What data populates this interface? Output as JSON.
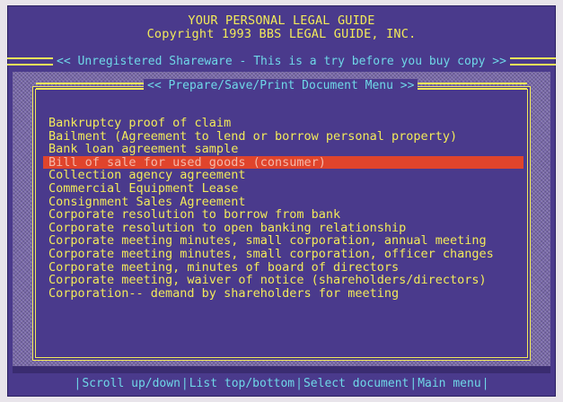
{
  "header": {
    "line1": "YOUR PERSONAL LEGAL GUIDE",
    "line2": "Copyright 1993 BBS LEGAL GUIDE, INC.",
    "banner": "<< Unregistered Shareware - This is a try before you buy copy >>"
  },
  "panel": {
    "title": "<< Prepare/Save/Print Document Menu >>"
  },
  "menu": {
    "selected_index": 3,
    "items": [
      "Bankruptcy proof of claim",
      "Bailment (Agreement to lend or borrow personal property)",
      "Bank loan agreement sample",
      "Bill of sale for used goods (consumer)",
      "Collection agency agreement",
      "Commercial Equipment Lease",
      "Consignment Sales Agreement",
      "Corporate resolution to borrow from bank",
      "Corporate resolution to open banking relationship",
      "Corporate meeting minutes, small corporation, annual meeting",
      "Corporate meeting minutes, small corporation, officer changes",
      "Corporate meeting, minutes of board of directors",
      "Corporate meeting, waiver of notice (shareholders/directors)",
      "Corporation-- demand by shareholders for meeting"
    ]
  },
  "status_bar": {
    "items": [
      "Scroll up/down",
      "List top/bottom",
      "Select document",
      "Main menu"
    ]
  },
  "colors": {
    "background": "#4a3a8c",
    "text": "#f2ea5a",
    "accent": "#6fd8e8",
    "highlight": "#e0442c"
  }
}
